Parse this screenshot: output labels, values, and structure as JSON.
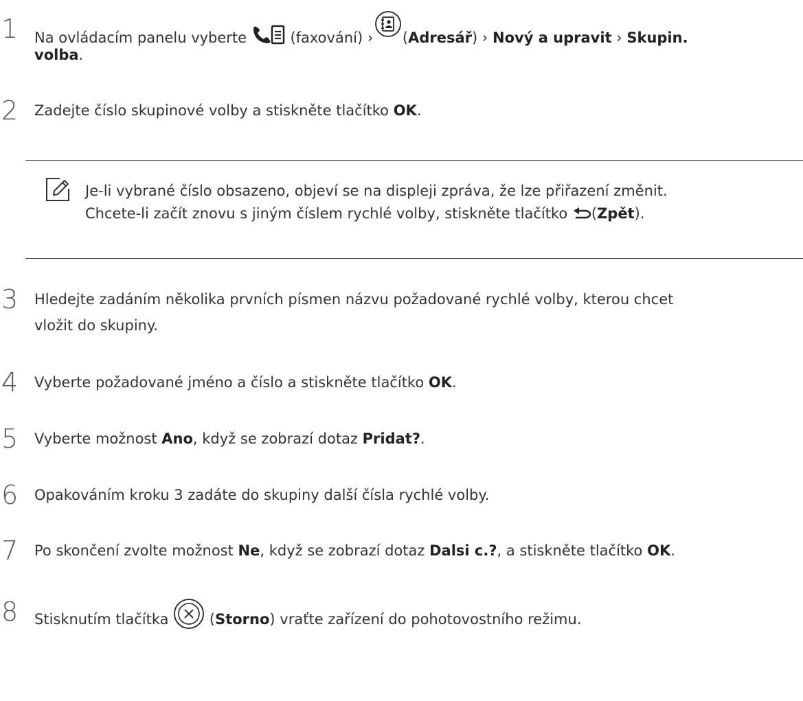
{
  "steps": [
    {
      "number": "1",
      "line1": {
        "t1": "Na ovládacím panelu vyberte ",
        "t2": " (faxování) › ",
        "t3": "(",
        "b1": "Adresář",
        "t4": ") › ",
        "b2": "Nový a upravit",
        "t5": " › ",
        "b3": "Skupin."
      },
      "line2": {
        "b1": "volba",
        "t1": "."
      }
    },
    {
      "number": "2",
      "t1": "Zadejte číslo skupinové volby a stiskněte tlačítko ",
      "b1": "OK",
      "t2": "."
    },
    {
      "number": "3",
      "line1": "Hledejte zadáním několika prvních písmen názvu požadované rychlé volby, kterou chcet",
      "line2": "vložit do skupiny."
    },
    {
      "number": "4",
      "t1": "Vyberte požadované jméno a číslo a stiskněte tlačítko ",
      "b1": "OK",
      "t2": "."
    },
    {
      "number": "5",
      "t1": "Vyberte možnost ",
      "b1": "Ano",
      "t2": ", když se zobrazí dotaz ",
      "b2": "Pridat?",
      "t3": "."
    },
    {
      "number": "6",
      "t1": "Opakováním kroku 3 zadáte do skupiny další čísla rychlé volby."
    },
    {
      "number": "7",
      "t1": "Po skončení zvolte možnost ",
      "b1": "Ne",
      "t2": ", když se zobrazí dotaz ",
      "b2": "Dalsi c.?",
      "t3": ", a stiskněte tlačítko ",
      "b3": "OK",
      "t4": "."
    },
    {
      "number": "8",
      "t1": "Stisknutím tlačítka ",
      "t2": " (",
      "b1": "Storno",
      "t3": ") vraťte zařízení do pohotovostního režimu."
    }
  ],
  "note": {
    "line1": "Je-li vybrané číslo obsazeno, objeví se na displeji zpráva, že lze přiřazení změnit.",
    "line2_t1": "Chcete-li začít znovu s jiným číslem rychlé volby, stiskněte tlačítko ",
    "line2_t2": "(",
    "line2_b1": "Zpět",
    "line2_t3": ")."
  },
  "icons": {
    "fax": "fax-icon",
    "address_book": "address-book-icon",
    "note": "note-pencil-icon",
    "back": "back-arrow-icon",
    "cancel": "cancel-x-icon"
  },
  "colors": {
    "text": "#333333",
    "rule": "#555555"
  }
}
